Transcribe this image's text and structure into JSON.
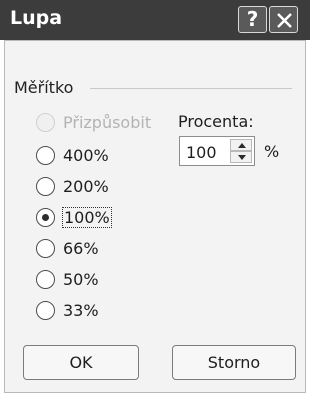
{
  "dialog": {
    "title": "Lupa",
    "help_label": "?",
    "close_label": "×"
  },
  "scale": {
    "legend": "Měřítko",
    "options": [
      {
        "label": "Přizpůsobit",
        "selected": false,
        "enabled": false
      },
      {
        "label": "400%",
        "selected": false,
        "enabled": true
      },
      {
        "label": "200%",
        "selected": false,
        "enabled": true
      },
      {
        "label": "100%",
        "selected": true,
        "enabled": true
      },
      {
        "label": "66%",
        "selected": false,
        "enabled": true
      },
      {
        "label": "50%",
        "selected": false,
        "enabled": true
      },
      {
        "label": "33%",
        "selected": false,
        "enabled": true
      }
    ]
  },
  "percent": {
    "label": "Procenta:",
    "value": "100",
    "unit": "%"
  },
  "buttons": {
    "ok": "OK",
    "cancel": "Storno"
  }
}
